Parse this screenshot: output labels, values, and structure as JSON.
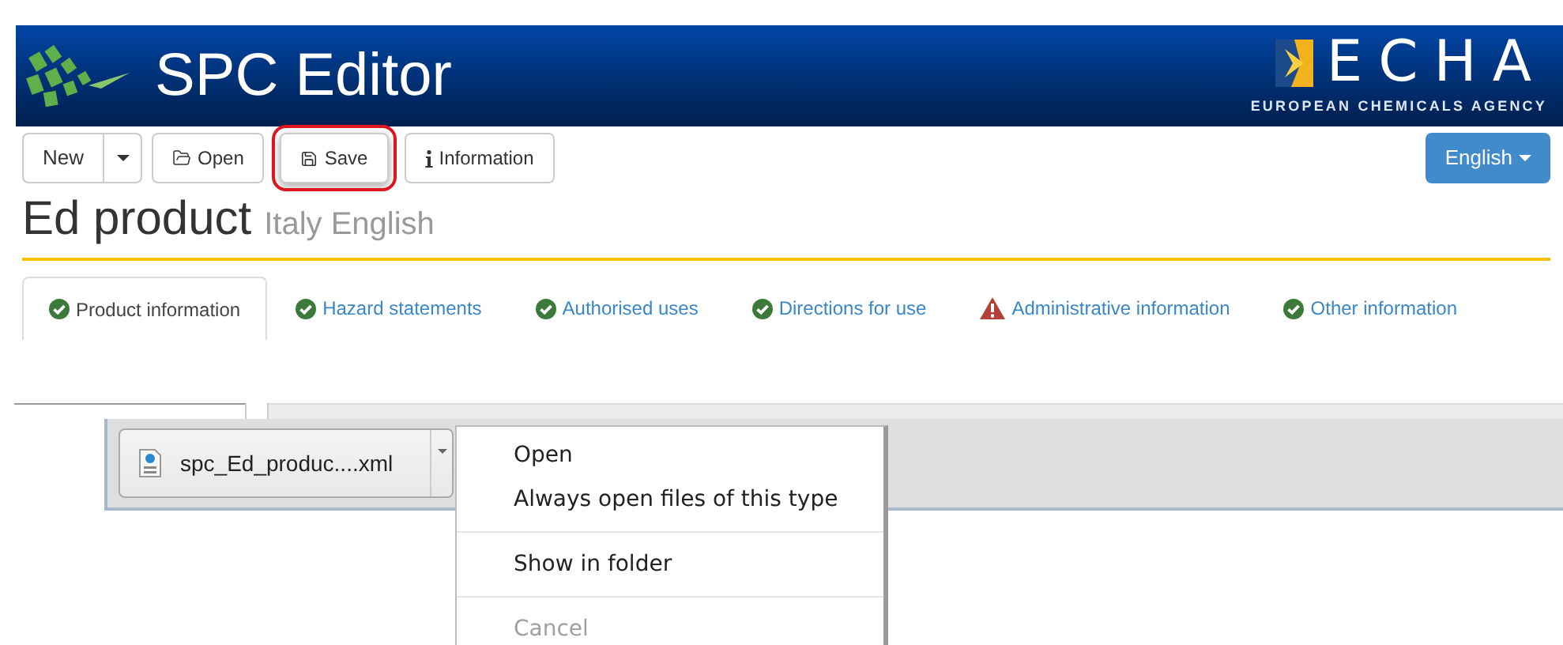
{
  "header": {
    "title": "SPC Editor",
    "logo_text": "ECHA",
    "logo_subtitle": "EUROPEAN CHEMICALS AGENCY"
  },
  "toolbar": {
    "buttons": [
      {
        "label": "New",
        "kind": "split",
        "highlighted": false
      },
      {
        "label": "Open",
        "kind": "open",
        "highlighted": false
      },
      {
        "label": "Save",
        "kind": "save",
        "highlighted": true
      },
      {
        "label": "Information",
        "kind": "info",
        "highlighted": false
      }
    ],
    "language": "English"
  },
  "product": {
    "name": "Ed product",
    "subtitle": "Italy English"
  },
  "tabs": [
    {
      "label": "Product information",
      "selected": true,
      "kind": "ok"
    },
    {
      "label": "Hazard statements",
      "selected": false,
      "kind": "ok"
    },
    {
      "label": "Authorised uses",
      "selected": false,
      "kind": "ok"
    },
    {
      "label": "Directions for use",
      "selected": false,
      "kind": "ok"
    },
    {
      "label": "Administrative information",
      "selected": false,
      "kind": "warning"
    },
    {
      "label": "Other information",
      "selected": false,
      "kind": "ok"
    }
  ],
  "download": {
    "file": "spc_Ed_produc....xml"
  },
  "context_menu": {
    "groups": [
      [
        {
          "label": "Open",
          "disabled": false
        },
        {
          "label": "Always open files of this type",
          "disabled": false
        }
      ],
      [
        {
          "label": "Show in folder",
          "disabled": false
        }
      ],
      [
        {
          "label": "Cancel",
          "disabled": true
        }
      ]
    ]
  }
}
